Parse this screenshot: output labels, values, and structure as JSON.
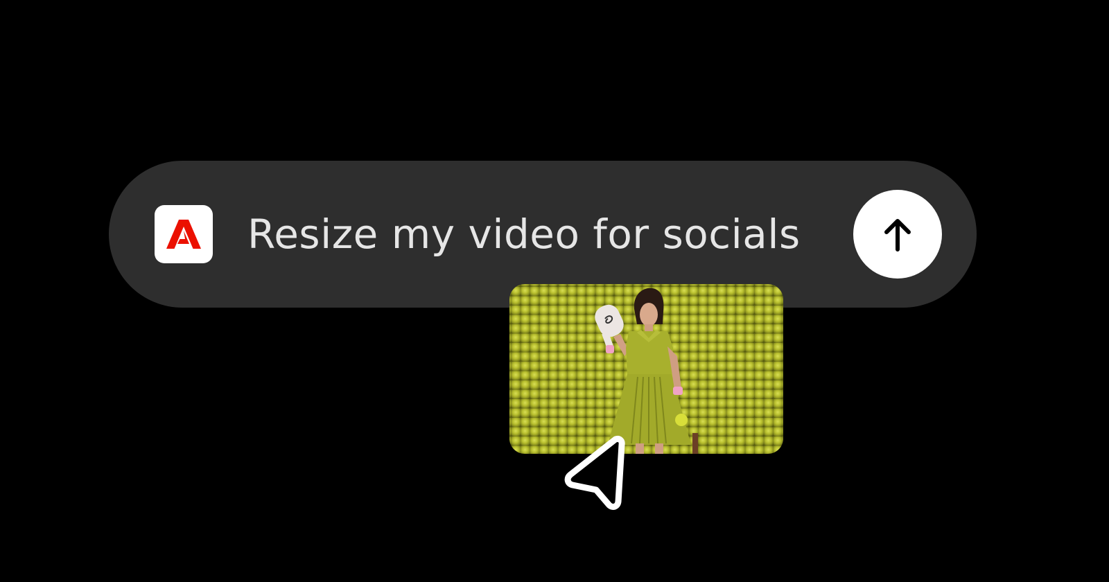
{
  "prompt": {
    "text": "Resize my video for socials",
    "app_icon": "adobe-logo-icon",
    "send_icon": "arrow-up-icon"
  },
  "video": {
    "icon": "video-thumbnail"
  },
  "cursor": {
    "icon": "mouse-pointer-icon"
  },
  "colors": {
    "background": "#000000",
    "bar": "#2e2e2e",
    "text": "#e6e6e6",
    "adobe_red": "#eb1000",
    "thumb_green": "#b9c02f"
  }
}
